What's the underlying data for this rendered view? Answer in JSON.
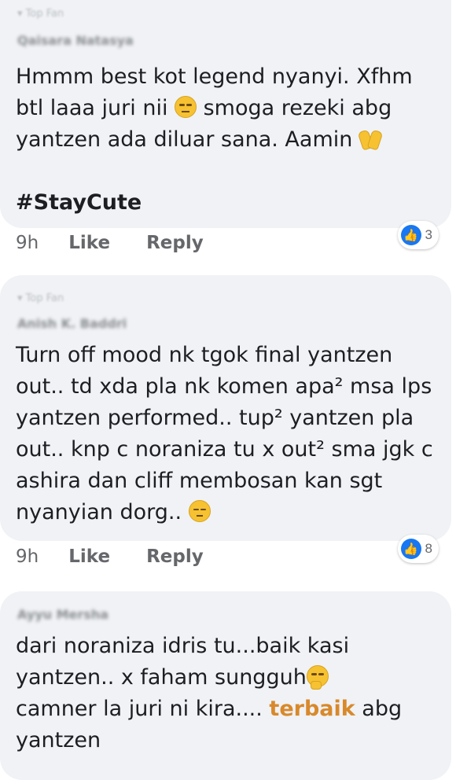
{
  "comments": [
    {
      "badge": "Top Fan",
      "author": "Qaisara Natasya",
      "text_main": "Hmmm best kot legend nyanyi. Xfhm btl laaa juri nii ",
      "text_mid": " smoga rezeki abg yantzen ada diluar sana. Aamin ",
      "hashtag": "#StayCute",
      "emoji_1": "expressionless-face",
      "emoji_2": "open-hands",
      "time": "9h",
      "like_label": "Like",
      "reply_label": "Reply",
      "reaction_count": "3",
      "reaction_icon": "thumbs-up-icon"
    },
    {
      "badge": "Top Fan",
      "author": "Anish K. Baddri",
      "text_main": "Turn off mood nk tgok final yantzen out.. td xda pla nk komen apa² msa lps yantzen performed.. tup² yantzen pla out.. knp c noraniza tu x out² sma jgk c ashira dan cliff membosan kan sgt nyanyian dorg.. ",
      "emoji_1": "unamused-face",
      "time": "9h",
      "like_label": "Like",
      "reply_label": "Reply",
      "reaction_count": "8",
      "reaction_icon": "thumbs-up-icon"
    },
    {
      "author": "Ayyu Mersha",
      "text_main": "dari noraniza idris tu...baik kasi yantzen.. x faham sungguh",
      "text_after": "camner la juri ni kira.... ",
      "highlight": "terbaik",
      "text_end": " abg yantzen",
      "emoji_1": "thinking-face"
    }
  ],
  "colors": {
    "bubble": "#f0f2f5",
    "text": "#1c1e21",
    "meta": "#65676b",
    "like_blue": "#1877f2",
    "highlight": "#d8892b"
  }
}
